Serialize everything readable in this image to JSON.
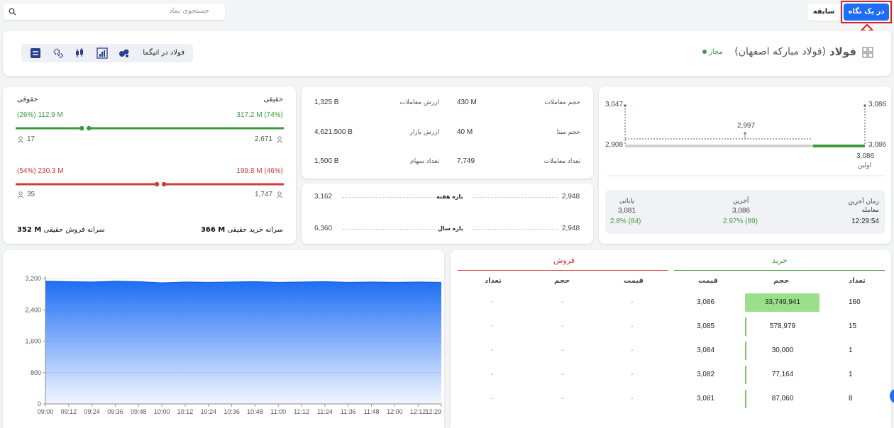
{
  "topbar": {
    "search_placeholder": "جستجوی نماد",
    "tab_glance": "در یک نگاه",
    "tab_history": "سابقه"
  },
  "header": {
    "symbol": "فولاد",
    "company": "(فولاد مبارکه اصفهان)",
    "status": "مجاز",
    "insights_link": "فولاد در انیگما"
  },
  "price_range": {
    "top_left": "3,047",
    "top_right": "3,086",
    "mid": "2,997",
    "left": "2,908",
    "right": "3,086",
    "first_value": "3,086",
    "first_label": "اولین"
  },
  "summary": {
    "last_trade_label": "زمان آخرین\nمعامله",
    "last_trade_time": "12:29:54",
    "last_label": "آخرین",
    "last_value": "3,086",
    "last_change": "2.97% (89)",
    "close_label": "پایانی",
    "close_value": "3,081",
    "close_change": "2.8% (84)"
  },
  "stats": [
    {
      "label": "حجم معاملات",
      "value": "430 M",
      "label2": "ارزش معاملات",
      "value2": "1,325 B"
    },
    {
      "label": "حجم مبنا",
      "value": "40 M",
      "label2": "ارزش بازار",
      "value2": "4,621,500 B"
    },
    {
      "label": "تعداد معاملات",
      "value": "7,749",
      "label2": "تعداد سهام",
      "value2": "1,500 B"
    }
  ],
  "ranges": [
    {
      "label": "بازه هفته",
      "min": "2,948",
      "max": "3,162"
    },
    {
      "label": "بازه سال",
      "min": "2,948",
      "max": "6,360"
    }
  ],
  "flow": {
    "real_label_r": "حقیقی",
    "real_label_l": "حقوقی",
    "buy_real": "317.2 M (74%)",
    "buy_legal": "(26%) 112.9 M",
    "buy_real_count": "2,671",
    "buy_legal_count": "17",
    "buy_fill": 0.74,
    "sell_real": "199.8 M (46%)",
    "sell_legal": "(54%) 230.3 M",
    "sell_real_count": "1,747",
    "sell_legal_count": "35",
    "sell_fill": 0.46,
    "per_capita_buy_label": "سرانه خرید حقیقی",
    "per_capita_buy": "366 M",
    "per_capita_sell_label": "سرانه فروش حقیقی",
    "per_capita_sell": "352 M"
  },
  "orderbook": {
    "buy_title": "خرید",
    "sell_title": "فروش",
    "col_count": "تعداد",
    "col_volume": "حجم",
    "col_price": "قیمت",
    "rows": [
      {
        "count": "160",
        "volume": "33,749,941",
        "price": "3,086",
        "bar": 1.0
      },
      {
        "count": "15",
        "volume": "578,979",
        "price": "3,085",
        "bar": 0.02
      },
      {
        "count": "1",
        "volume": "30,000",
        "price": "3,084",
        "bar": 0.01
      },
      {
        "count": "1",
        "volume": "77,164",
        "price": "3,082",
        "bar": 0.01
      },
      {
        "count": "8",
        "volume": "87,060",
        "price": "3,081",
        "bar": 0.01
      }
    ],
    "sell_empty": "-"
  },
  "colors": {
    "accent": "#1e6ef5",
    "green": "#3c9a3c",
    "red": "#d23b3b"
  },
  "chart_data": {
    "type": "area",
    "ylim": [
      0,
      3200
    ],
    "yticks": [
      "0",
      "800",
      "1,600",
      "2,400",
      "3,200"
    ],
    "x": [
      "09:00",
      "09:12",
      "09:24",
      "09:36",
      "09:48",
      "10:00",
      "10:12",
      "10:24",
      "10:36",
      "10:48",
      "11:00",
      "11:12",
      "11:24",
      "11:36",
      "11:48",
      "12:00",
      "12:12",
      "12:29"
    ],
    "values": [
      3130,
      3120,
      3110,
      3130,
      3120,
      3090,
      3110,
      3100,
      3110,
      3120,
      3100,
      3110,
      3120,
      3100,
      3110,
      3100,
      3110,
      3100
    ],
    "color": "#1e6ef5"
  }
}
